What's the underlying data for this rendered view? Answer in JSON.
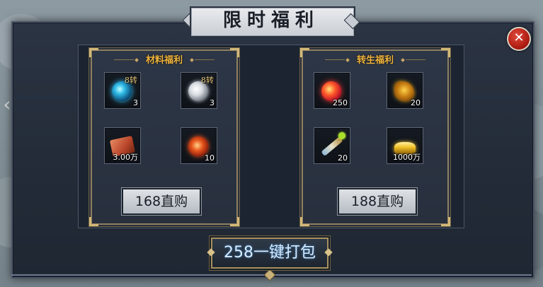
{
  "title": "限时福利",
  "close_icon": "close-icon",
  "panels": [
    {
      "title": "材料福利",
      "items": [
        {
          "icon": "blue-orb-icon",
          "tier": "8转",
          "qty": "3"
        },
        {
          "icon": "white-orb-icon",
          "tier": "8转",
          "qty": "3"
        },
        {
          "icon": "red-book-icon",
          "tier": "",
          "qty": "3.00万"
        },
        {
          "icon": "fire-orb-icon",
          "tier": "",
          "qty": "10"
        }
      ],
      "buy_label": "168直购"
    },
    {
      "title": "转生福利",
      "items": [
        {
          "icon": "red-gem-icon",
          "tier": "",
          "qty": "250"
        },
        {
          "icon": "golden-creature-icon",
          "tier": "",
          "qty": "20"
        },
        {
          "icon": "scroll-icon",
          "tier": "",
          "qty": "20"
        },
        {
          "icon": "gold-ingot-icon",
          "tier": "",
          "qty": "1000万"
        }
      ],
      "buy_label": "188直购"
    }
  ],
  "bundle_label": "258一键打包",
  "colors": {
    "accent_gold": "#f0b43c",
    "bundle_text": "#d7ecff"
  }
}
